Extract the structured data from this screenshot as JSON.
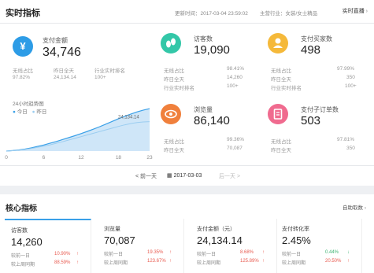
{
  "header": {
    "title": "实时指标",
    "update_time_label": "更新时间：2017-03-04 23:59:02",
    "industry_label": "主营行业：女装/女士精品",
    "realtime_button": "实时直播",
    "realtime_icon": "chevron-right-icon"
  },
  "pay_amount": {
    "icon": "yen-icon",
    "icon_glyph": "¥",
    "color": "#2d9ce6",
    "label": "支付金额",
    "value": "34,746",
    "sub1_label": "无线占比",
    "sub1_value": "97.82%",
    "sub2_label": "昨日全天",
    "sub2_value": "24,134.14",
    "sub3_label": "行业实时排名",
    "sub3_value": "100+"
  },
  "chart_data": {
    "type": "area",
    "title": "24小时趋势图",
    "series": [
      {
        "name": "今日",
        "values": [
          0,
          400,
          900,
          1600,
          2600,
          3800,
          5000,
          6400,
          7800,
          9400,
          11000,
          12600,
          14300,
          16100,
          18000,
          20000,
          22100,
          24300,
          26500,
          28500,
          30400,
          32100,
          33600,
          34746
        ]
      },
      {
        "name": "昨日",
        "values": [
          0,
          300,
          700,
          1300,
          2100,
          3000,
          4000,
          5100,
          6300,
          7600,
          9000,
          10400,
          11800,
          13200,
          14600,
          16000,
          17400,
          18800,
          20200,
          21500,
          22600,
          23400,
          23900,
          24134
        ]
      }
    ],
    "x_ticks": [
      "0",
      "6",
      "12",
      "18",
      "23"
    ],
    "annotation": "24,134.14",
    "colors": [
      "#3aa0e8",
      "#9bcdf0"
    ]
  },
  "legend": {
    "today_label": "今日",
    "yesterday_label": "昨日"
  },
  "visitors": {
    "icon": "footprint-icon",
    "color": "#33c7a8",
    "label": "访客数",
    "value": "19,090",
    "sub1_label": "无线占比",
    "sub1_value": "98.41%",
    "sub2_label": "昨日全天",
    "sub2_value": "14,260",
    "sub3_label": "行业实时排名",
    "sub3_value": "100+"
  },
  "buyers": {
    "icon": "buyer-icon",
    "color": "#f5b93a",
    "label": "支付买家数",
    "value": "498",
    "sub1_label": "无线占比",
    "sub1_value": "97.99%",
    "sub2_label": "昨日全天",
    "sub2_value": "350",
    "sub3_label": "行业实时排名",
    "sub3_value": "100+"
  },
  "pageviews": {
    "icon": "eye-icon",
    "color": "#f0803c",
    "label": "浏览量",
    "value": "86,140",
    "sub1_label": "无线占比",
    "sub1_value": "99.36%",
    "sub2_label": "昨日全天",
    "sub2_value": "70,087"
  },
  "sub_orders": {
    "icon": "order-icon",
    "color": "#f06b8f",
    "label": "支付子订单数",
    "value": "503",
    "sub1_label": "无线占比",
    "sub1_value": "97.81%",
    "sub2_label": "昨日全天",
    "sub2_value": "350"
  },
  "datebar": {
    "prev": "< 前一天",
    "date": "2017-03-03",
    "next": "后一天 >"
  },
  "core": {
    "title": "核心指标",
    "auto_label": "自助取数",
    "cards": [
      {
        "label": "访客数",
        "value": "14,260",
        "r1_label": "较前一日",
        "r1_pct": "10.90%",
        "r1_arrow": "↑",
        "r2_label": "较上周同期",
        "r2_pct": "88.59%",
        "r2_arrow": "↑"
      },
      {
        "label": "浏览量",
        "value": "70,087",
        "r1_label": "较前一日",
        "r1_pct": "19.35%",
        "r1_arrow": "↑",
        "r2_label": "较上周同期",
        "r2_pct": "123.67%",
        "r2_arrow": "↑"
      },
      {
        "label": "支付金额（元）",
        "value": "24,134.14",
        "r1_label": "较前一日",
        "r1_pct": "8.68%",
        "r1_arrow": "↑",
        "r2_label": "较上周同期",
        "r2_pct": "125.89%",
        "r2_arrow": "↑"
      },
      {
        "label": "支付转化率",
        "value": "2.45%",
        "r1_label": "较前一日",
        "r1_pct": "0.44%",
        "r1_arrow": "↓",
        "r2_label": "较上周同期",
        "r2_pct": "20.50%",
        "r2_arrow": "↑"
      }
    ]
  }
}
